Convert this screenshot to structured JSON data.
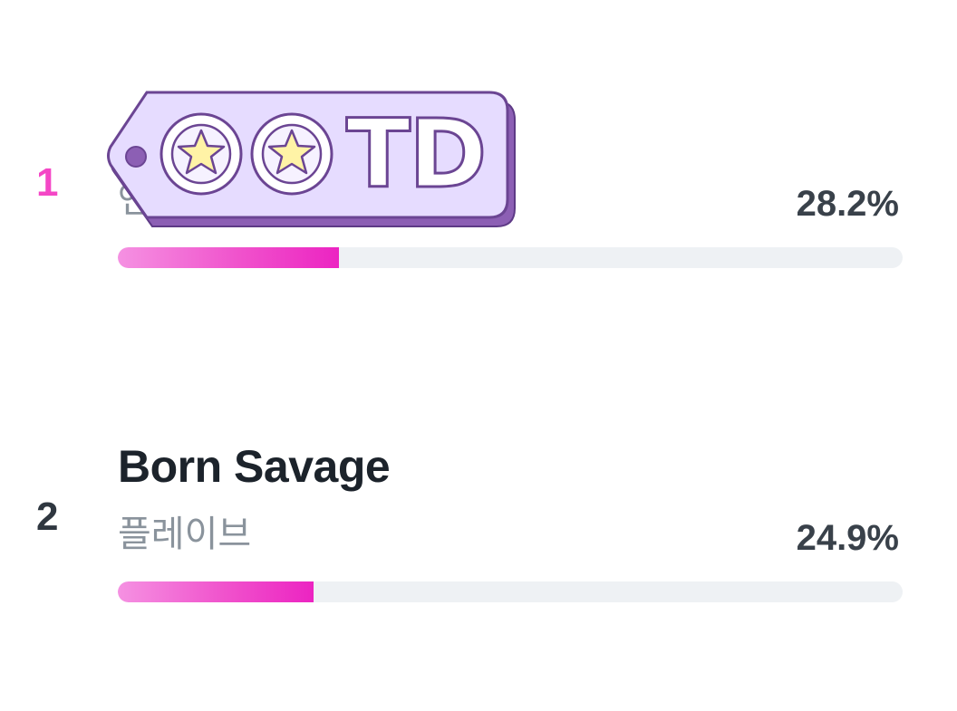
{
  "ranking": [
    {
      "rank": "1",
      "rank_color": "#f447c6",
      "title": "",
      "artist": "엔",
      "percent": "28.2%",
      "share": 0.282
    },
    {
      "rank": "2",
      "rank_color": "#2f3740",
      "title": "Born Savage",
      "artist": "플레이브",
      "percent": "24.9%",
      "share": 0.249
    }
  ],
  "sticker": {
    "text": "TD",
    "icons": [
      "star-icon",
      "star-icon"
    ]
  },
  "colors": {
    "accent": "#ec24c2",
    "track": "#eef1f4",
    "sticker_fill": "#e6dcff",
    "sticker_shadow": "#8c5fb4"
  }
}
